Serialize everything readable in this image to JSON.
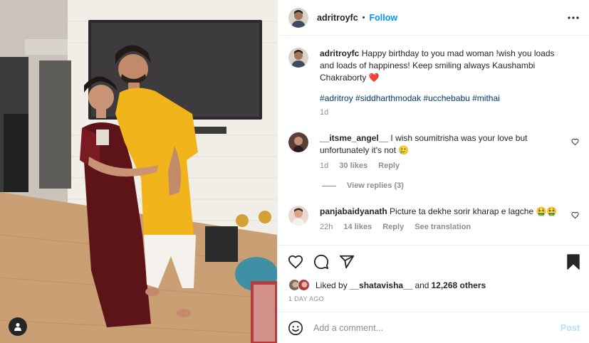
{
  "post": {
    "photo_alt": "",
    "username": "adritroyfc",
    "dot": "•",
    "follow_label": "Follow"
  },
  "caption": {
    "username": "adritroyfc",
    "text": "Happy birthday to you mad woman !wish you loads and loads of happiness! Keep smiling always Kaushambi Chakraborty ",
    "emoji": "❤️",
    "hashtags": "#adritroy #siddharthmodak #ucchebabu #mithai",
    "age": "1d"
  },
  "comments": [
    {
      "username": "__itsme_angel__",
      "text": "I wish soumitrisha was your love but unfortunately it's not 🥲",
      "age": "1d",
      "likes": "30 likes",
      "reply_label": "Reply",
      "view_replies": "View replies (3)"
    },
    {
      "username": "panjabaidyanath",
      "text": "Picture ta dekhe sorir kharap e lagche 🤮🤮",
      "age": "22h",
      "likes": "14 likes",
      "reply_label": "Reply",
      "translate_label": "See translation"
    }
  ],
  "likes": {
    "prefix": "Liked by ",
    "user": "__shatavisha__",
    "middle": " and ",
    "count": "12,268 others"
  },
  "posted_ago": "1 DAY AGO",
  "add_comment": {
    "placeholder": "Add a comment...",
    "post_label": "Post"
  },
  "icons": {
    "more": "more-horizontal-icon",
    "like": "heart-icon",
    "comment": "comment-bubble-icon",
    "share": "paper-plane-icon",
    "save": "bookmark-filled-icon",
    "emoji": "smiley-icon",
    "tag": "user-tag-icon"
  },
  "colors": {
    "accent": "#0095f6",
    "heart": "#ed4956",
    "hashtag": "#00376b",
    "muted": "#8e8e8e"
  }
}
